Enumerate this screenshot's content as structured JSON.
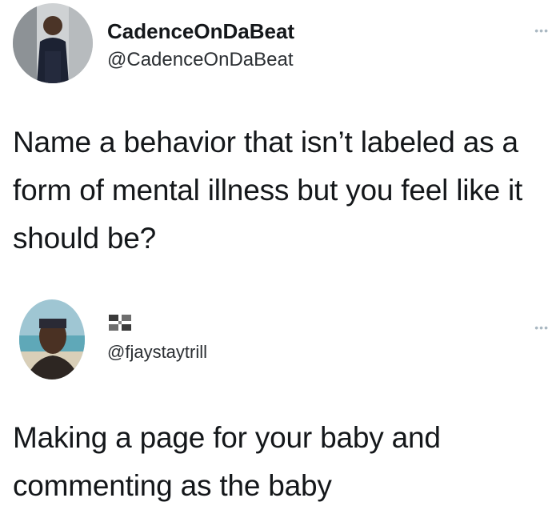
{
  "tweets": [
    {
      "display_name": "CadenceOnDaBeat",
      "handle": "@CadenceOnDaBeat",
      "more_icon": "ellipsis-icon",
      "text": "Name a behavior that isn’t labeled as a form of mental illness but you feel like it should be?"
    },
    {
      "handle": "@fjaystaytrill",
      "flag_icon": "flag-icon",
      "more_icon": "ellipsis-icon",
      "text": "Making a page for your baby and commenting as the baby"
    }
  ],
  "colors": {
    "text": "#14171a",
    "secondary_text": "#2b2f33",
    "muted": "#aab8c2",
    "background": "#ffffff"
  },
  "more_glyph": "•••"
}
